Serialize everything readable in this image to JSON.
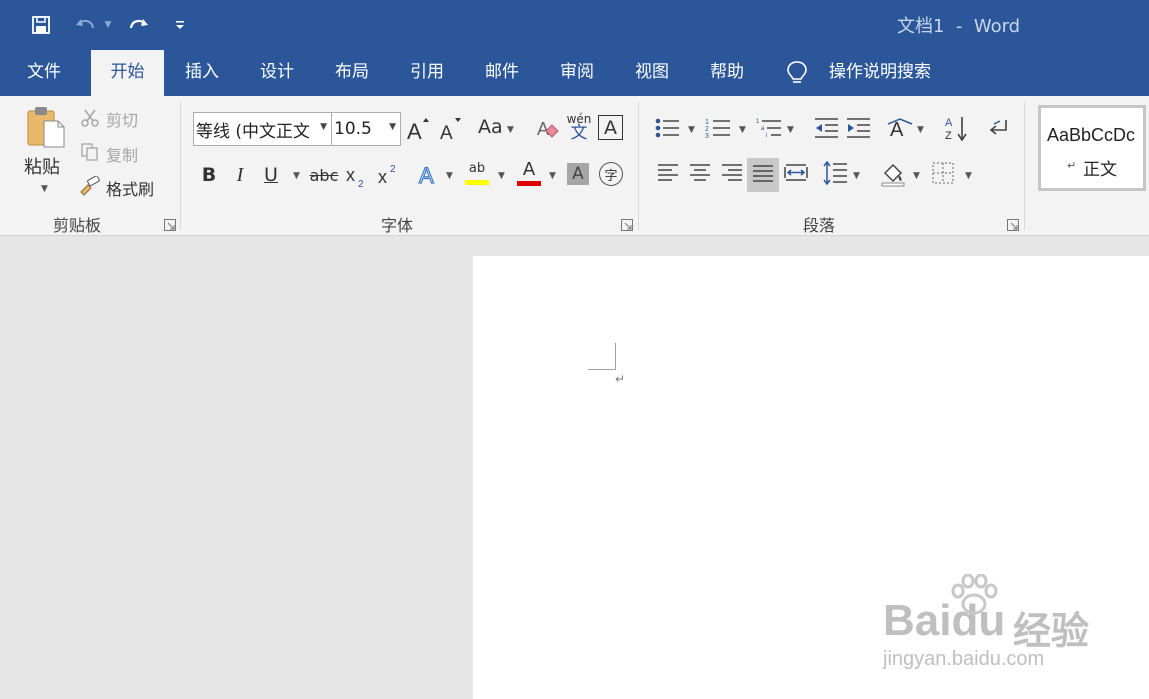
{
  "window": {
    "title": "文档1  -  Word"
  },
  "colors": {
    "brand": "#2b579a",
    "ribbon_bg": "#f3f3f3",
    "canvas_bg": "#e6e6e6",
    "highlight_yellow": "#ffff00",
    "font_red": "#e00000"
  },
  "tabs": [
    {
      "label": "文件"
    },
    {
      "label": "开始",
      "active": true
    },
    {
      "label": "插入"
    },
    {
      "label": "设计"
    },
    {
      "label": "布局"
    },
    {
      "label": "引用"
    },
    {
      "label": "邮件"
    },
    {
      "label": "审阅"
    },
    {
      "label": "视图"
    },
    {
      "label": "帮助"
    }
  ],
  "tell_me": {
    "label": "操作说明搜索",
    "icon": "lightbulb-icon"
  },
  "clipboard": {
    "group_label": "剪贴板",
    "paste_label": "粘贴",
    "cut_label": "剪切",
    "copy_label": "复制",
    "format_painter_label": "格式刷"
  },
  "font": {
    "group_label": "字体",
    "font_name": "等线 (中文正文",
    "font_size": "10.5",
    "case_label": "Aa",
    "phonetic_label": "wén",
    "phonetic_char": "文",
    "char_border_label": "A",
    "enclose_char": "字",
    "strike_sample": "abc",
    "highlight_sample": "ab"
  },
  "paragraph": {
    "group_label": "段落"
  },
  "styles": {
    "preview": "AaBbCcDc",
    "name": "正文"
  },
  "document": {
    "paragraph_mark": "↵"
  },
  "watermark": {
    "brand": "Baidu",
    "cn": "经验",
    "url": "jingyan.baidu.com"
  }
}
